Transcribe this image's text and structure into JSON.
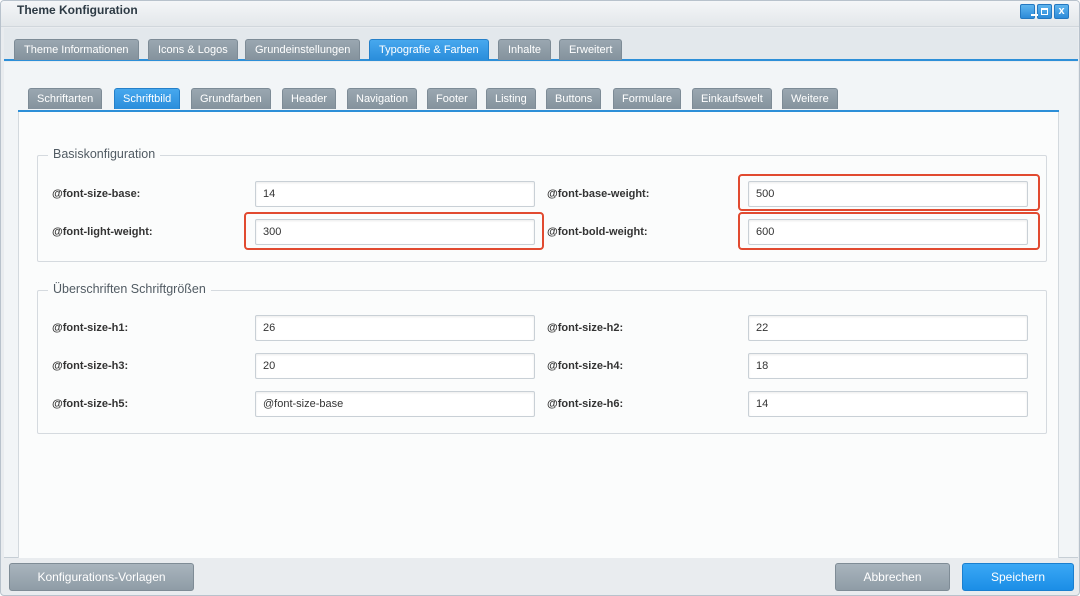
{
  "window": {
    "title": "Theme Konfiguration",
    "controls": {
      "close": "x"
    }
  },
  "main_tabs": [
    {
      "label": "Theme Informationen",
      "active": false
    },
    {
      "label": "Icons & Logos",
      "active": false
    },
    {
      "label": "Grundeinstellungen",
      "active": false
    },
    {
      "label": "Typografie & Farben",
      "active": true
    },
    {
      "label": "Inhalte",
      "active": false
    },
    {
      "label": "Erweitert",
      "active": false
    }
  ],
  "sub_tabs": [
    {
      "label": "Schriftarten",
      "active": false
    },
    {
      "label": "Schriftbild",
      "active": true
    },
    {
      "label": "Grundfarben",
      "active": false
    },
    {
      "label": "Header",
      "active": false
    },
    {
      "label": "Navigation",
      "active": false
    },
    {
      "label": "Footer",
      "active": false
    },
    {
      "label": "Listing",
      "active": false
    },
    {
      "label": "Buttons",
      "active": false
    },
    {
      "label": "Formulare",
      "active": false
    },
    {
      "label": "Einkaufswelt",
      "active": false
    },
    {
      "label": "Weitere",
      "active": false
    }
  ],
  "basis": {
    "legend": "Basiskonfiguration",
    "fields": [
      {
        "label": "@font-size-base:",
        "value": "14"
      },
      {
        "label": "@font-base-weight:",
        "value": "500"
      },
      {
        "label": "@font-light-weight:",
        "value": "300"
      },
      {
        "label": "@font-bold-weight:",
        "value": "600"
      }
    ]
  },
  "headings": {
    "legend": "Überschriften Schriftgrößen",
    "fields": [
      {
        "label": "@font-size-h1:",
        "value": "26"
      },
      {
        "label": "@font-size-h2:",
        "value": "22"
      },
      {
        "label": "@font-size-h3:",
        "value": "20"
      },
      {
        "label": "@font-size-h4:",
        "value": "18"
      },
      {
        "label": "@font-size-h5:",
        "value": "@font-size-base"
      },
      {
        "label": "@font-size-h6:",
        "value": "14"
      }
    ]
  },
  "footer": {
    "templates_label": "Konfigurations-Vorlagen",
    "cancel_label": "Abbrechen",
    "save_label": "Speichern"
  },
  "colors": {
    "accent": "#2d8fd8",
    "highlight": "#e14a30",
    "tab_inactive": "#8f9ca6"
  }
}
